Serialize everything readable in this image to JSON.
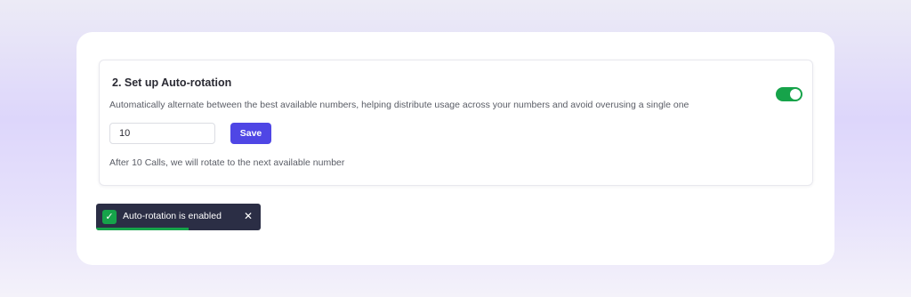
{
  "section": {
    "title": "2. Set up Auto-rotation",
    "description": "Automatically alternate between the best available numbers, helping distribute usage across your numbers and avoid overusing a single one",
    "toggle_enabled": true,
    "input_value": "10",
    "save_label": "Save",
    "helper_text": "After 10 Calls, we will rotate to the next available number"
  },
  "toast": {
    "message": "Auto-rotation is enabled",
    "check_glyph": "✓",
    "close_glyph": "✕",
    "progress_fraction": 0.56
  },
  "colors": {
    "accent": "#4f46e5",
    "success": "#16a34a",
    "toast_bg": "#2b2e45"
  },
  "icons": {
    "toggle": "toggle-switch-icon",
    "check": "check-icon",
    "close": "close-icon"
  }
}
